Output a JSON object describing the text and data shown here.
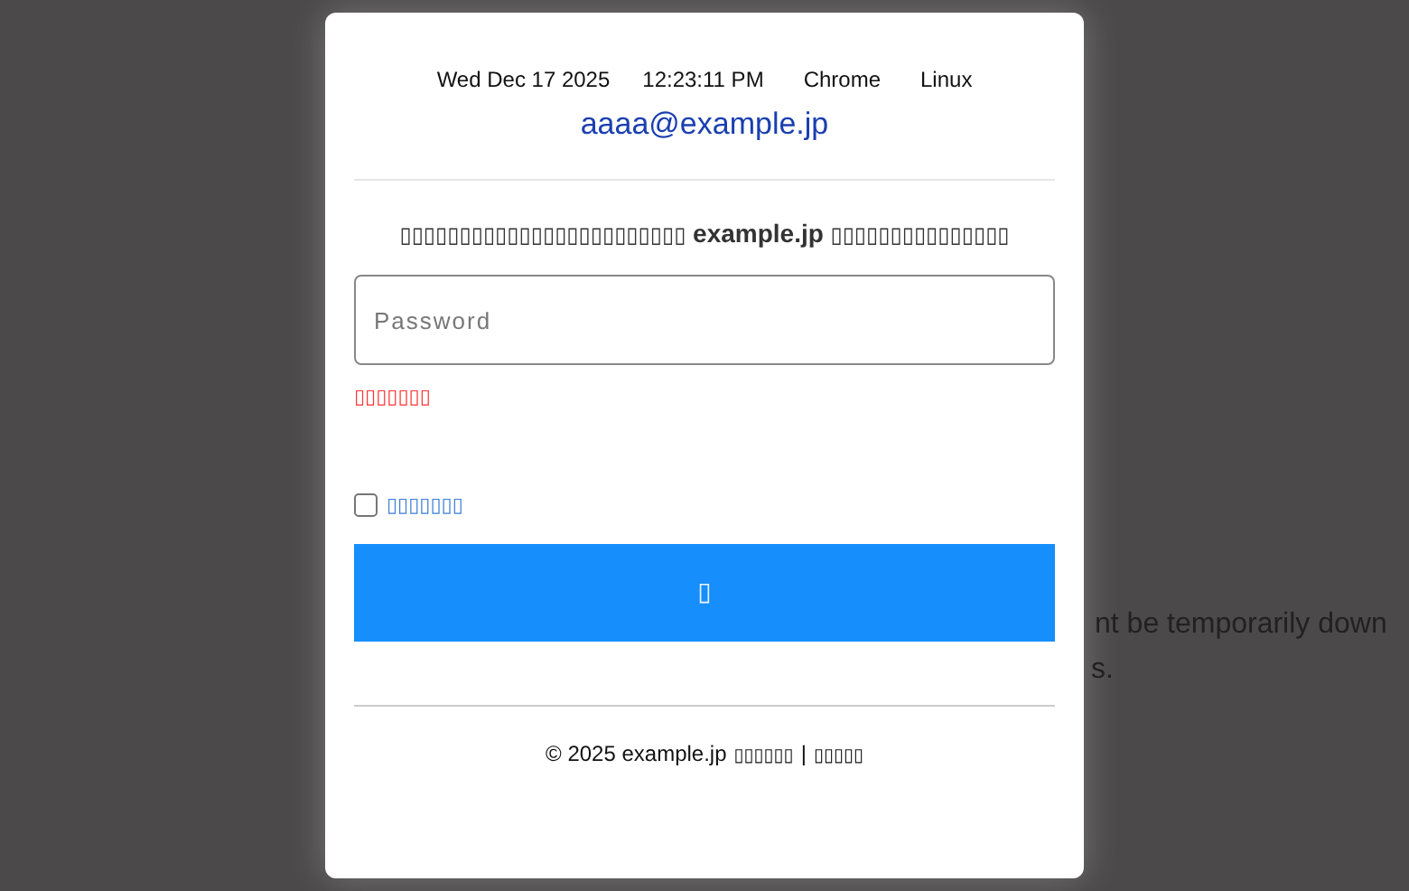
{
  "background_text": [
    "nt be temporarily down",
    "s."
  ],
  "dialog": {
    "info": [
      "Wed Dec 17 2025",
      "12:23:11 PM",
      "Chrome",
      "Linux"
    ],
    "email": "aaaa@example.jp",
    "message": "▯▯▯▯▯▯▯▯▯▯▯▯▯▯▯▯▯▯▯▯▯▯▯▯ **example.jp** ▯▯▯▯▯▯▯▯▯▯▯▯▯▯▯",
    "password": {
      "placeholder": "Password"
    },
    "error": "▯▯▯▯▯▯▯",
    "remember": {
      "label": "▯▯▯▯▯▯▯",
      "checked": false
    },
    "submit": "▯",
    "footer": {
      "copyright": "© 2025 example.jp",
      "link_1": "▯▯▯▯▯▯",
      "separator": "|",
      "link_2": "▯▯▯▯▯"
    }
  }
}
